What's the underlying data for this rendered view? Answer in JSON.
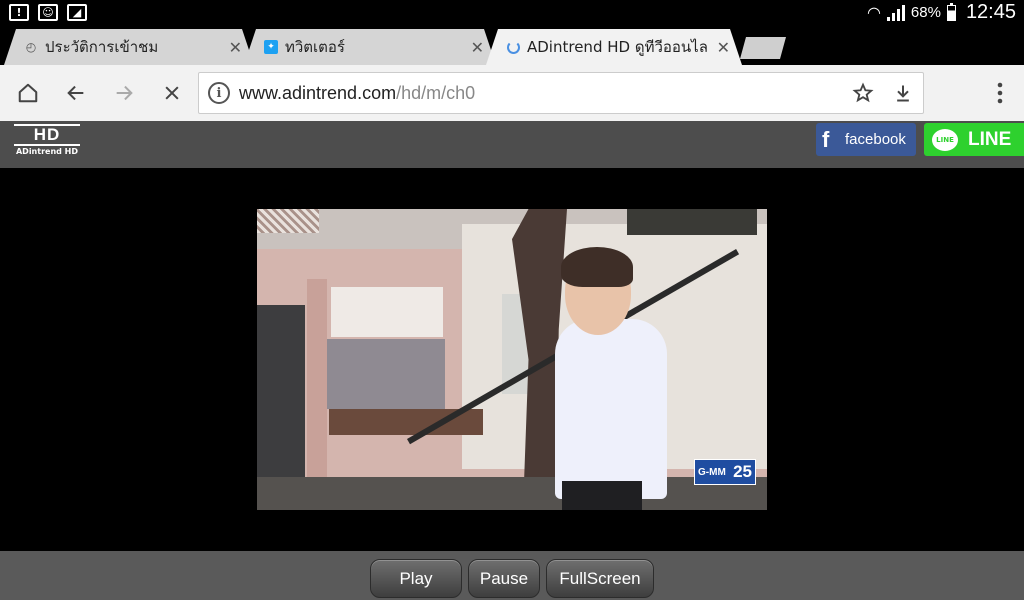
{
  "status_bar": {
    "battery": "68%",
    "time": "12:45",
    "notifications": [
      "alert-icon",
      "face-icon",
      "image-icon"
    ]
  },
  "tabs": [
    {
      "title": "ประวัติการเข้าชม",
      "favicon": "history-icon",
      "active": false
    },
    {
      "title": "ทวิตเตอร์",
      "favicon": "twitter-icon",
      "active": false
    },
    {
      "title": "ADintrend HD ดูทีวีออนไล",
      "favicon": "loading-spinner",
      "active": true
    }
  ],
  "toolbar": {
    "url_host": "www.adintrend.com",
    "url_path": "/hd/m/ch0"
  },
  "site": {
    "logo_main": "HD",
    "logo_sub": "ADintrend HD",
    "facebook_label": "facebook",
    "line_label": "LINE",
    "line_bubble": "LINE"
  },
  "video": {
    "channel_name": "G-MM",
    "channel_number": "25"
  },
  "controls": {
    "play": "Play",
    "pause": "Pause",
    "fullscreen": "FullScreen"
  },
  "colors": {
    "facebook": "#3b5998",
    "line": "#2ed12e",
    "header": "#4d4d4d"
  }
}
